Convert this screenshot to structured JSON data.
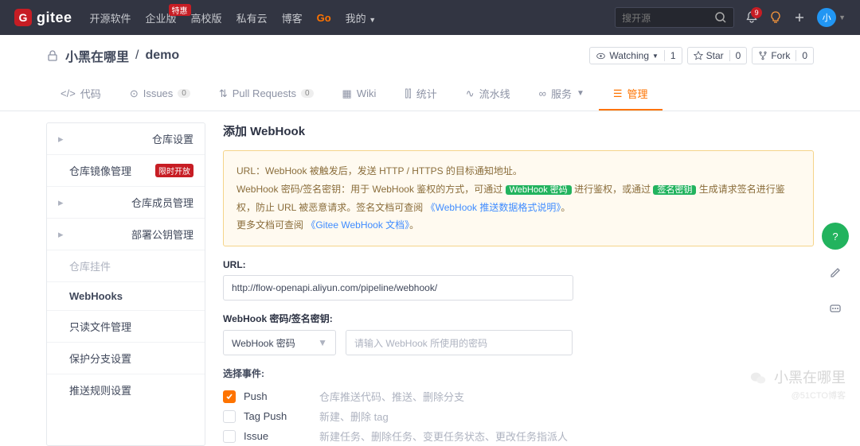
{
  "topbar": {
    "logo": "gitee",
    "nav": {
      "open": "开源软件",
      "enterprise": "企业版",
      "enterprise_badge": "特惠",
      "edu": "高校版",
      "private": "私有云",
      "blog": "博客",
      "go": "Go",
      "mine": "我的"
    },
    "search_placeholder": "搜开源",
    "notif_count": "9",
    "avatar_text": "小"
  },
  "repo": {
    "owner": "小黑在哪里",
    "name": "demo",
    "watching_label": "Watching",
    "watching_count": "1",
    "star_label": "Star",
    "star_count": "0",
    "fork_label": "Fork",
    "fork_count": "0"
  },
  "tabs": {
    "code": "代码",
    "issues": "Issues",
    "issues_count": "0",
    "pr": "Pull Requests",
    "pr_count": "0",
    "wiki": "Wiki",
    "stats": "统计",
    "pipeline": "流水线",
    "services": "服务",
    "manage": "管理"
  },
  "sidebar": {
    "items": [
      {
        "label": "仓库设置",
        "type": "group"
      },
      {
        "label": "仓库镜像管理",
        "badge": "限时开放"
      },
      {
        "label": "仓库成员管理",
        "type": "group"
      },
      {
        "label": "部署公钥管理",
        "type": "group"
      },
      {
        "label": "仓库挂件",
        "type": "disabled"
      },
      {
        "label": "WebHooks",
        "type": "active"
      },
      {
        "label": "只读文件管理"
      },
      {
        "label": "保护分支设置"
      },
      {
        "label": "推送规则设置"
      }
    ]
  },
  "content": {
    "title": "添加 WebHook",
    "info_line1": "URL：WebHook 被触发后，发送 HTTP / HTTPS 的目标通知地址。",
    "info_line2a": "WebHook 密码/签名密钥：用于 WebHook 鉴权的方式，可通过 ",
    "info_tag1": "WebHook 密码",
    "info_line2b": " 进行鉴权，或通过 ",
    "info_tag2": "签名密钥",
    "info_line2c": " 生成请求签名进行鉴权，防止 URL 被恶意请求。签名文档可查阅 ",
    "info_link1": "《WebHook 推送数据格式说明》",
    "info_period": "。",
    "info_line3a": "更多文档可查阅 ",
    "info_link2": "《Gitee WebHook 文档》",
    "url_label": "URL:",
    "url_value": "http://flow-openapi.aliyun.com/pipeline/webhook/",
    "pw_label": "WebHook 密码/签名密钥:",
    "pw_select": "WebHook 密码",
    "pw_placeholder": "请输入 WebHook 所使用的密码",
    "events_label": "选择事件:",
    "events": [
      {
        "name": "Push",
        "desc": "仓库推送代码、推送、删除分支",
        "checked": true
      },
      {
        "name": "Tag Push",
        "desc": "新建、删除 tag",
        "checked": false
      },
      {
        "name": "Issue",
        "desc": "新建任务、删除任务、变更任务状态、更改任务指派人",
        "checked": false
      }
    ]
  },
  "watermark": {
    "main": "小黑在哪里",
    "sub": "@51CTO博客"
  }
}
